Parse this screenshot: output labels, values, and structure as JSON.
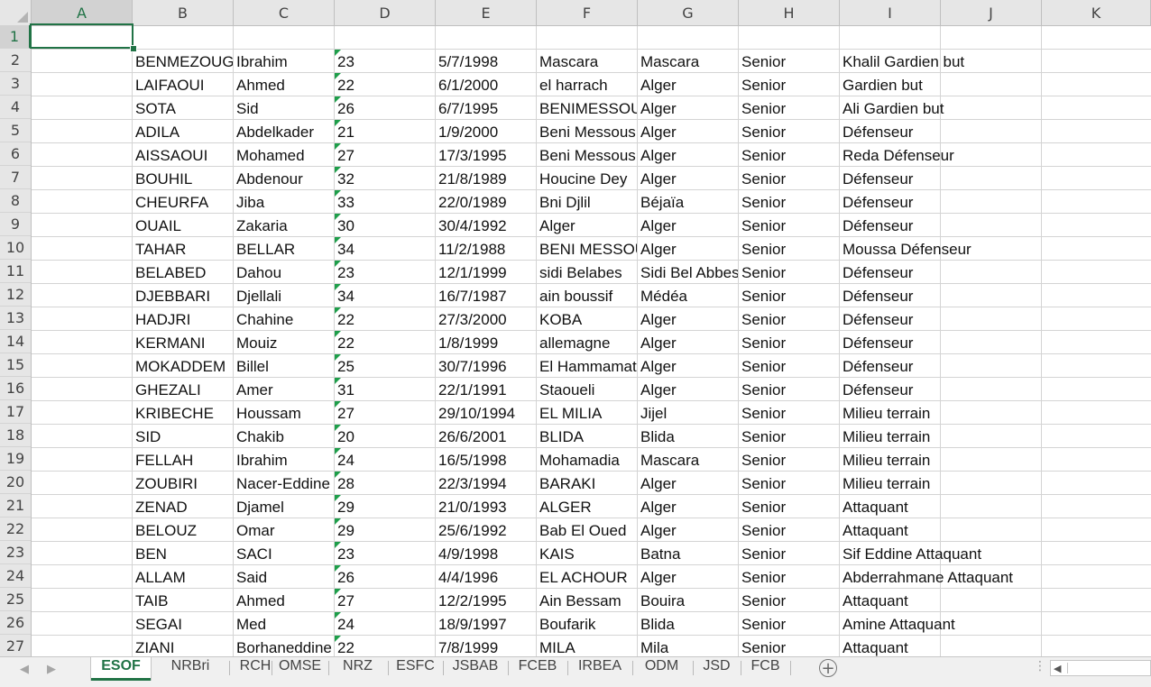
{
  "columns": [
    "A",
    "B",
    "C",
    "D",
    "E",
    "F",
    "G",
    "H",
    "I",
    "J",
    "K"
  ],
  "selected_cell": {
    "column": "A",
    "row": "1"
  },
  "rows": [
    {
      "num": "1",
      "cells": [
        "",
        "",
        "",
        "",
        "",
        "",
        "",
        ""
      ]
    },
    {
      "num": "2",
      "cells": [
        "BENMEZOUG",
        "Ibrahim",
        "23",
        "5/7/1998",
        "Mascara",
        "Mascara",
        "Senior",
        "Khalil Gardien but"
      ]
    },
    {
      "num": "3",
      "cells": [
        "LAIFAOUI",
        "Ahmed",
        "22",
        "6/1/2000",
        "el harrach",
        "Alger",
        "Senior",
        "Gardien but"
      ]
    },
    {
      "num": "4",
      "cells": [
        "SOTA",
        "Sid",
        "26",
        "6/7/1995",
        "BENIMESSOUS",
        "Alger",
        "Senior",
        "Ali Gardien but"
      ]
    },
    {
      "num": "5",
      "cells": [
        "ADILA",
        "Abdelkader",
        "21",
        "1/9/2000",
        "Beni Messous",
        "Alger",
        "Senior",
        "Défenseur"
      ]
    },
    {
      "num": "6",
      "cells": [
        "AISSAOUI",
        "Mohamed",
        "27",
        "17/3/1995",
        "Beni Messous",
        "Alger",
        "Senior",
        "Reda Défenseur"
      ]
    },
    {
      "num": "7",
      "cells": [
        "BOUHIL",
        "Abdenour",
        "32",
        "21/8/1989",
        "Houcine Dey",
        "Alger",
        "Senior",
        "Défenseur"
      ]
    },
    {
      "num": "8",
      "cells": [
        "CHEURFA",
        "Jiba",
        "33",
        "22/0/1989",
        "Bni Djlil",
        "Béjaïa",
        "Senior",
        "Défenseur"
      ]
    },
    {
      "num": "9",
      "cells": [
        "OUAIL",
        "Zakaria",
        "30",
        "30/4/1992",
        "Alger",
        "Alger",
        "Senior",
        "Défenseur"
      ]
    },
    {
      "num": "10",
      "cells": [
        "TAHAR",
        "BELLAR",
        "34",
        "11/2/1988",
        "BENI MESSOUS",
        "Alger",
        "Senior",
        "Moussa Défenseur"
      ]
    },
    {
      "num": "11",
      "cells": [
        "BELABED",
        "Dahou",
        "23",
        "12/1/1999",
        "sidi Belabes",
        "Sidi Bel Abbes",
        "Senior",
        "Défenseur"
      ]
    },
    {
      "num": "12",
      "cells": [
        "DJEBBARI",
        "Djellali",
        "34",
        "16/7/1987",
        "ain boussif",
        "Médéa",
        "Senior",
        "Défenseur"
      ]
    },
    {
      "num": "13",
      "cells": [
        "HADJRI",
        "Chahine",
        "22",
        "27/3/2000",
        "KOBA",
        "Alger",
        "Senior",
        "Défenseur"
      ]
    },
    {
      "num": "14",
      "cells": [
        "KERMANI",
        "Mouiz",
        "22",
        "1/8/1999",
        "allemagne",
        "Alger",
        "Senior",
        "Défenseur"
      ]
    },
    {
      "num": "15",
      "cells": [
        "MOKADDEM",
        "Billel",
        "25",
        "30/7/1996",
        "El Hammamat",
        "Alger",
        "Senior",
        "Défenseur"
      ]
    },
    {
      "num": "16",
      "cells": [
        "GHEZALI",
        "Amer",
        "31",
        "22/1/1991",
        "Staoueli",
        "Alger",
        "Senior",
        "Défenseur"
      ]
    },
    {
      "num": "17",
      "cells": [
        "KRIBECHE",
        "Houssam",
        "27",
        "29/10/1994",
        "EL MILIA",
        "Jijel",
        "Senior",
        "Milieu terrain"
      ]
    },
    {
      "num": "18",
      "cells": [
        "SID",
        "Chakib",
        "20",
        "26/6/2001",
        "BLIDA",
        "Blida",
        "Senior",
        "Milieu terrain"
      ]
    },
    {
      "num": "19",
      "cells": [
        "FELLAH",
        "Ibrahim",
        "24",
        "16/5/1998",
        "Mohamadia",
        "Mascara",
        "Senior",
        "Milieu terrain"
      ]
    },
    {
      "num": "20",
      "cells": [
        "ZOUBIRI",
        "Nacer-Eddine",
        "28",
        "22/3/1994",
        "BARAKI",
        "Alger",
        "Senior",
        "Milieu terrain"
      ]
    },
    {
      "num": "21",
      "cells": [
        "ZENAD",
        "Djamel",
        "29",
        "21/0/1993",
        "ALGER",
        "Alger",
        "Senior",
        "Attaquant"
      ]
    },
    {
      "num": "22",
      "cells": [
        "BELOUZ",
        "Omar",
        "29",
        "25/6/1992",
        "Bab El Oued",
        "Alger",
        "Senior",
        "Attaquant"
      ]
    },
    {
      "num": "23",
      "cells": [
        "BEN",
        "SACI",
        "23",
        "4/9/1998",
        "KAIS",
        "Batna",
        "Senior",
        "Sif Eddine Attaquant"
      ]
    },
    {
      "num": "24",
      "cells": [
        "ALLAM",
        "Said",
        "26",
        "4/4/1996",
        "EL ACHOUR",
        "Alger",
        "Senior",
        "Abderrahmane Attaquant"
      ]
    },
    {
      "num": "25",
      "cells": [
        "TAIB",
        "Ahmed",
        "27",
        "12/2/1995",
        "Ain Bessam",
        "Bouira",
        "Senior",
        "Attaquant"
      ]
    },
    {
      "num": "26",
      "cells": [
        "SEGAI",
        "Med",
        "24",
        "18/9/1997",
        "Boufarik",
        "Blida",
        "Senior",
        "Amine Attaquant"
      ]
    },
    {
      "num": "27",
      "cells": [
        "ZIANI",
        "Borhaneddine",
        "22",
        "7/8/1999",
        "MILA",
        "Mila",
        "Senior",
        "Attaquant"
      ]
    }
  ],
  "tabs": [
    "ESOF",
    "NRBri",
    "RCH",
    "OMSE",
    "NRZ",
    "ESFC",
    "JSBAB",
    "FCEB",
    "IRBEA",
    "ODM",
    "JSD",
    "FCB"
  ],
  "active_tab": "ESOF",
  "colors": {
    "accent": "#217346",
    "error_indicator": "#1e9e4a"
  },
  "icons": {
    "add_sheet": "plus-circle-icon",
    "nav_prev": "triangle-left-icon",
    "nav_next": "triangle-right-icon"
  }
}
